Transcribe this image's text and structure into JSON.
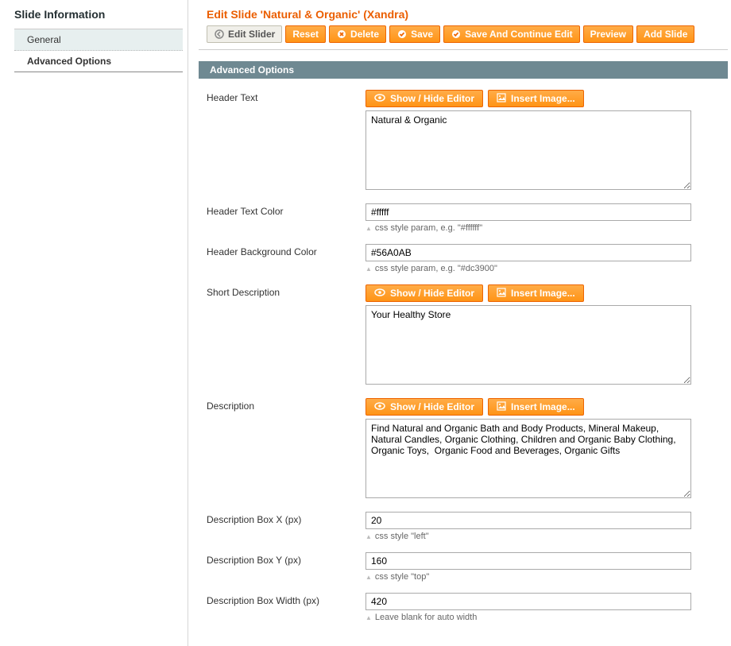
{
  "sidebar": {
    "title": "Slide Information",
    "tabs": [
      {
        "label": "General"
      },
      {
        "label": "Advanced Options"
      }
    ]
  },
  "header": {
    "page_title": "Edit Slide 'Natural & Organic' (Xandra)",
    "buttons": {
      "edit_slider": "Edit Slider",
      "reset": "Reset",
      "delete": "Delete",
      "save": "Save",
      "save_continue": "Save And Continue Edit",
      "preview": "Preview",
      "add_slide": "Add Slide"
    }
  },
  "section_title": "Advanced Options",
  "editor_buttons": {
    "show_hide": "Show / Hide Editor",
    "insert_image": "Insert Image..."
  },
  "fields": {
    "header_text": {
      "label": "Header Text",
      "value": "Natural & Organic"
    },
    "header_text_color": {
      "label": "Header Text Color",
      "value": "#fffff",
      "hint": "css style param, e.g. \"#ffffff\""
    },
    "header_bg_color": {
      "label": "Header Background Color",
      "value": "#56A0AB",
      "hint": "css style param, e.g. \"#dc3900\""
    },
    "short_desc": {
      "label": "Short Description",
      "value": "Your Healthy Store"
    },
    "description": {
      "label": "Description",
      "value": "Find Natural and Organic Bath and Body Products, Mineral Makeup, Natural Candles, Organic Clothing, Children and Organic Baby Clothing, Organic Toys,  Organic Food and Beverages, Organic Gifts"
    },
    "desc_box_x": {
      "label": "Description Box X (px)",
      "value": "20",
      "hint": "css style \"left\""
    },
    "desc_box_y": {
      "label": "Description Box Y (px)",
      "value": "160",
      "hint": "css style \"top\""
    },
    "desc_box_width": {
      "label": "Description Box Width (px)",
      "value": "420",
      "hint": "Leave blank for auto width"
    }
  }
}
